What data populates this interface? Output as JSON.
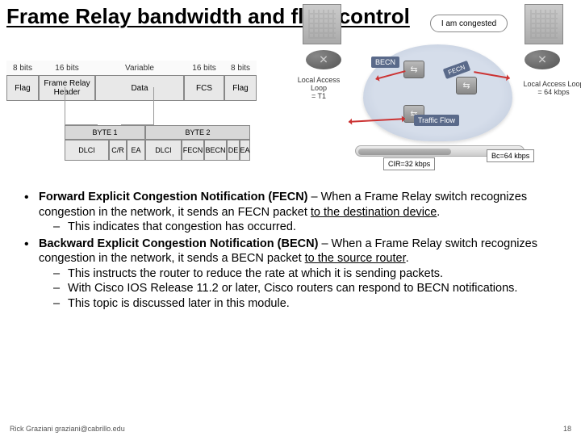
{
  "title": "Frame Relay bandwidth and flow control",
  "frame": {
    "bits": [
      "8 bits",
      "16 bits",
      "Variable",
      "16 bits",
      "8 bits"
    ],
    "labels": [
      "Flag",
      "Frame Relay Header",
      "Data",
      "FCS",
      "Flag"
    ]
  },
  "bytes": {
    "headers": [
      "BYTE 1",
      "BYTE 2"
    ],
    "fields": [
      "DLCI",
      "C/R",
      "EA",
      "DLCI",
      "FECN",
      "BECN",
      "DE",
      "EA"
    ]
  },
  "net": {
    "bubble": "I am congested",
    "becn": "BECN",
    "fecn": "FECN",
    "flow": "Traffic Flow",
    "lal_left_l1": "Local Access Loop",
    "lal_left_l2": "= T1",
    "lal_right_l1": "Local Access Loop",
    "lal_right_l2": "= 64 kbps",
    "cir": "CIR=32 kbps",
    "bc": "Bc=64 kbps"
  },
  "bullets": {
    "b1_bold": "Forward Explicit Congestion Notification (FECN)",
    "b1_rest1": " – When a Frame Relay switch recognizes congestion in the network, it sends an FECN packet ",
    "b1_ul": "to the destination device",
    "b1_rest2": ".",
    "b1_sub1": "This indicates that congestion has occurred.",
    "b2_bold": "Backward Explicit Congestion Notification (BECN)",
    "b2_rest1": " – When a Frame Relay switch recognizes congestion in the network, it sends a BECN packet ",
    "b2_ul": "to the source router",
    "b2_rest2": ".",
    "b2_sub1": "This instructs the router to reduce the rate at which it is sending packets.",
    "b2_sub2": "With Cisco IOS Release 11.2 or later, Cisco routers can respond to BECN notifications.",
    "b2_sub3": "This topic is discussed later in this module."
  },
  "footer": {
    "left": "Rick Graziani graziani@cabrillo.edu",
    "right": "18"
  }
}
